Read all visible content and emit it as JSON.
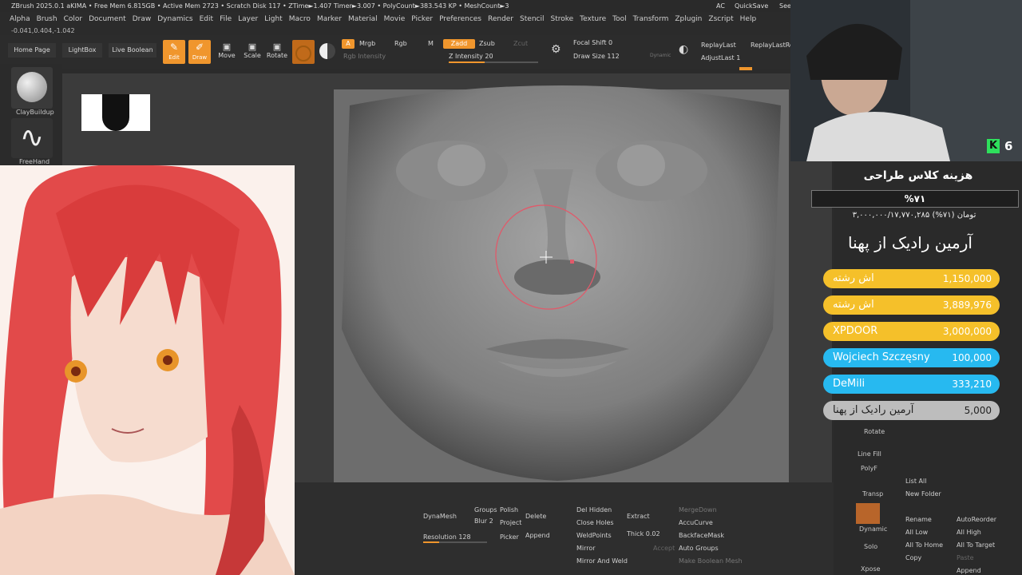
{
  "titlebar": {
    "text": "ZBrush 2025.0.1   aKIMA   • Free Mem 6.815GB • Active Mem 2723 • Scratch Disk 117 • ZTime►1.407 Timer►3.007 • PolyCount►383.543 KP • MeshCount►3",
    "ac": "AC",
    "quicksave": "QuickSave",
    "see": "See"
  },
  "menu": [
    "Alpha",
    "Brush",
    "Color",
    "Document",
    "Draw",
    "Dynamics",
    "Edit",
    "File",
    "Layer",
    "Light",
    "Macro",
    "Marker",
    "Material",
    "Movie",
    "Picker",
    "Preferences",
    "Render",
    "Stencil",
    "Stroke",
    "Texture",
    "Tool",
    "Transform",
    "Zplugin",
    "Zscript",
    "Help"
  ],
  "coords": "-0.041,0.404,-1.042",
  "toolbar": {
    "home_page": "Home Page",
    "lightbox": "LightBox",
    "live_boolean": "Live Boolean",
    "edit": "Edit",
    "draw": "Draw",
    "move": "Move",
    "scale": "Scale",
    "rotate": "Rotate",
    "a": "A",
    "mrgb": "Mrgb",
    "rgb": "Rgb",
    "m": "M",
    "zadd": "Zadd",
    "zsub": "Zsub",
    "zcut": "Zcut",
    "rgb_intensity": "Rgb Intensity",
    "z_intensity": "Z Intensity 20",
    "focal_shift": "Focal Shift 0",
    "draw_size": "Draw Size 112",
    "dynamic": "Dynamic",
    "replay_last": "ReplayLast",
    "replay_last_rel": "ReplayLastRe",
    "adjust_last": "AdjustLast 1"
  },
  "shelf": {
    "brush1": "ClayBuildup",
    "brush2": "FreeHand"
  },
  "webcam": {
    "k_badge": "6"
  },
  "overlay": {
    "goal_title": "هزینه کلاس طراحی",
    "goal_percent": "%۷۱",
    "goal_amount": "۳,۰۰۰,۰۰۰/۱۷,۷۷۰,۲۸۵ تومان (۷۱%)",
    "top_supporter": "آرمین رادیک از پهنا"
  },
  "donations": [
    {
      "name": "اش رشته",
      "amount": "1,150,000",
      "color": "#f5c02a"
    },
    {
      "name": "اش رشته",
      "amount": "3,889,976",
      "color": "#f5c02a"
    },
    {
      "name": "XPDOOR",
      "amount": "3,000,000",
      "color": "#f5c02a"
    },
    {
      "name": "Wojciech Szczęsny",
      "amount": "100,000",
      "color": "#27b9f0"
    },
    {
      "name": "DeMili",
      "amount": "333,210",
      "color": "#27b9f0"
    },
    {
      "name": "آرمین رادیک از پهنا",
      "amount": "5,000",
      "color": "#bdbdbd"
    }
  ],
  "rightpanel": {
    "rotate": "Rotate",
    "line_fill": "Line Fill",
    "polyf": "PolyF",
    "transp": "Transp",
    "dynamic": "Dynamic",
    "solo": "Solo",
    "xpose": "Xpose",
    "list_all": "List All",
    "new_folder": "New Folder",
    "rename": "Rename",
    "auto_reorder": "AutoReorder",
    "all_low": "All Low",
    "all_high": "All High",
    "all_to_home": "All To Home",
    "all_to_target": "All To Target",
    "copy": "Copy",
    "paste": "Paste",
    "append": "Append"
  },
  "bottom": {
    "dynamesh": "DynaMesh",
    "groups": "Groups",
    "polish": "Polish",
    "blur": "Blur 2",
    "project": "Project",
    "delete": "Delete",
    "resolution": "Resolution 128",
    "picker": "Picker",
    "append": "Append",
    "del_hidden": "Del Hidden",
    "close_holes": "Close Holes",
    "weld_points": "WeldPoints",
    "mirror": "Mirror",
    "mirror_and_weld": "Mirror And Weld",
    "extract": "Extract",
    "thick": "Thick 0.02",
    "accept": "Accept",
    "merge_down": "MergeDown",
    "accucurve": "AccuCurve",
    "backface_mask": "BackfaceMask",
    "auto_groups": "Auto Groups",
    "make_boolean_mesh": "Make Boolean Mesh"
  }
}
